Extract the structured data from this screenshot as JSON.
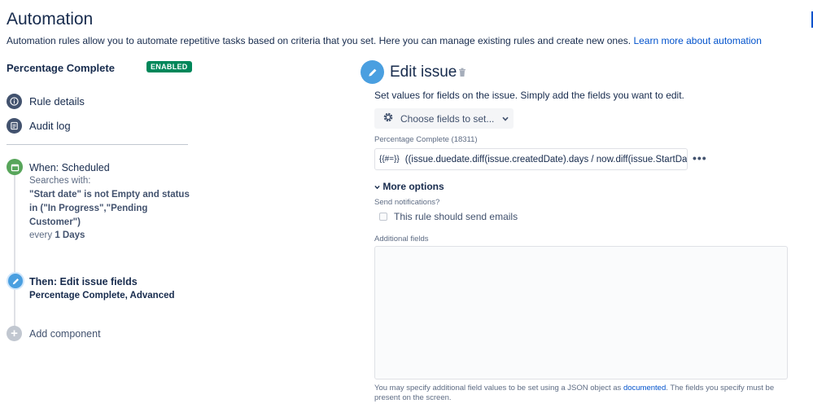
{
  "page": {
    "title": "Automation",
    "description": "Automation rules allow you to automate repetitive tasks based on criteria that you set. Here you can manage existing rules and create new ones.",
    "learn_more_link": "Learn more about automation"
  },
  "rule": {
    "name": "Percentage Complete",
    "status_badge": "ENABLED"
  },
  "nav": {
    "rule_details": "Rule details",
    "audit_log": "Audit log"
  },
  "trigger": {
    "title": "When: Scheduled",
    "searches_with": "Searches with:",
    "jql_line1": "\"Start date\" is not Empty and status",
    "jql_line2": "in (\"In Progress\",\"Pending",
    "jql_line3": "Customer\")",
    "every_prefix": "every",
    "every_value": "1 Days"
  },
  "action": {
    "title": "Then: Edit issue fields",
    "subtitle": "Percentage Complete, Advanced"
  },
  "add_component": "Add component",
  "editor": {
    "title": "Edit issue",
    "description": "Set values for fields on the issue. Simply add the fields you want to edit.",
    "choose_fields": "Choose fields to set...",
    "field_label": "Percentage Complete (18311)",
    "field_prefix": "{{#=}}",
    "field_value": "((issue.duedate.diff(issue.createdDate).days / now.diff(issue.StartDate).da",
    "more_dots": "•••",
    "more_options": "More options",
    "send_notifications_label": "Send notifications?",
    "send_emails_checkbox": "This rule should send emails",
    "additional_fields_label": "Additional fields",
    "footer_part1": "You may specify additional field values to be set using a JSON object as",
    "footer_link": "documented",
    "footer_part2": ". The fields you specify must be present on the screen."
  },
  "icons": {
    "info": "info-icon",
    "log": "list-icon",
    "trigger": "calendar-icon",
    "action": "pencil-icon",
    "add": "plus-icon",
    "trash": "trash-icon",
    "gear": "gear-icon",
    "chevron": "chevron-down-icon"
  },
  "colors": {
    "enabled_badge": "#00875a",
    "trigger_green": "#57a55a",
    "action_blue": "#4a9fe0",
    "link_blue": "#0052cc"
  }
}
